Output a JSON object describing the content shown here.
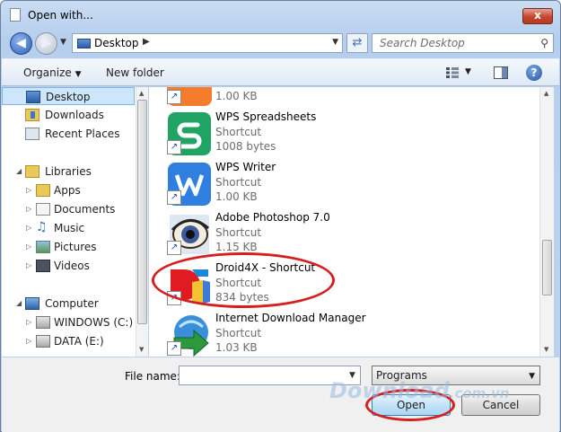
{
  "window": {
    "title": "Open with...",
    "close_label": "x"
  },
  "address": {
    "location": "Desktop",
    "search_placeholder": "Search Desktop"
  },
  "toolbar": {
    "organize": "Organize",
    "new_folder": "New folder",
    "help": "?"
  },
  "nav": {
    "items": [
      {
        "label": "Desktop",
        "icon": "desktop-icon"
      },
      {
        "label": "Downloads",
        "icon": "downloads-folder-icon"
      },
      {
        "label": "Recent Places",
        "icon": "recent-places-icon"
      },
      {
        "label": "Libraries",
        "icon": "libraries-icon"
      },
      {
        "label": "Apps",
        "icon": "folder-icon"
      },
      {
        "label": "Documents",
        "icon": "documents-icon"
      },
      {
        "label": "Music",
        "icon": "music-icon"
      },
      {
        "label": "Pictures",
        "icon": "pictures-icon"
      },
      {
        "label": "Videos",
        "icon": "videos-icon"
      },
      {
        "label": "Computer",
        "icon": "computer-icon"
      },
      {
        "label": "WINDOWS (C:)",
        "icon": "drive-icon"
      },
      {
        "label": "DATA (E:)",
        "icon": "drive-icon"
      }
    ]
  },
  "files": [
    {
      "name": "",
      "type": "",
      "size": "1.00 KB",
      "icon": "partial-app-icon",
      "color": "#f47c2a"
    },
    {
      "name": "WPS Spreadsheets",
      "type": "Shortcut",
      "size": "1008 bytes",
      "icon": "wps-spreadsheets-icon",
      "color": "#1fa463"
    },
    {
      "name": "WPS Writer",
      "type": "Shortcut",
      "size": "1.00 KB",
      "icon": "wps-writer-icon",
      "color": "#2f7fe0"
    },
    {
      "name": "Adobe Photoshop 7.0",
      "type": "Shortcut",
      "size": "1.15 KB",
      "icon": "photoshop-eye-icon",
      "color": "#3a5a9c"
    },
    {
      "name": "Droid4X - Shortcut",
      "type": "Shortcut",
      "size": "834 bytes",
      "icon": "droid4x-icon",
      "color": "#e01b22"
    },
    {
      "name": "Internet Download Manager",
      "type": "Shortcut",
      "size": "1.03 KB",
      "icon": "idm-icon",
      "color": "#2c9a3c"
    }
  ],
  "footer": {
    "file_name_label": "File name:",
    "file_name_value": "",
    "file_type": "Programs",
    "open": "Open",
    "cancel": "Cancel"
  },
  "watermark": {
    "main": "Download",
    "suffix": ".com.vn"
  },
  "colors": {
    "highlight": "#d42020",
    "selection": "#cde6fb"
  }
}
